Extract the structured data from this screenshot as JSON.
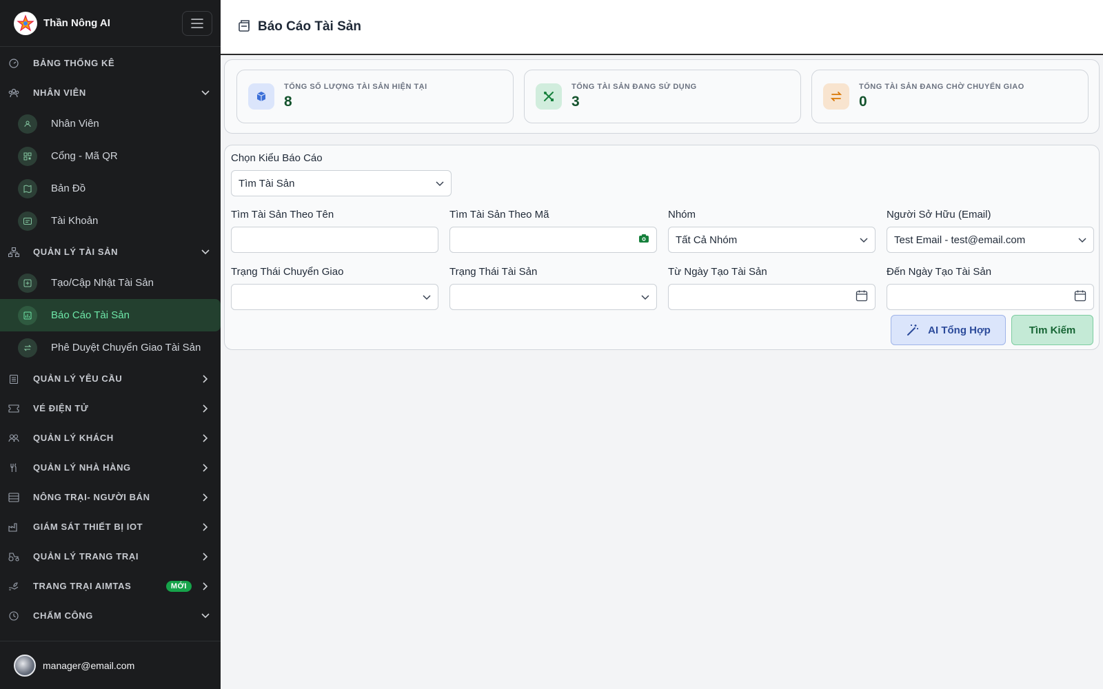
{
  "sidebar": {
    "brand": "Thần Nông AI",
    "sections": [
      {
        "label": "BẢNG THỐNG KÊ"
      },
      {
        "label": "NHÂN VIÊN",
        "items": [
          "Nhân Viên",
          "Cổng - Mã QR",
          "Bản Đồ",
          "Tài Khoản"
        ]
      },
      {
        "label": "QUẢN LÝ TÀI SẢN",
        "items": [
          "Tạo/Cập Nhật Tài Sản",
          "Báo Cáo Tài Sản",
          "Phê Duyệt Chuyển Giao Tài Sản"
        ]
      },
      {
        "label": "QUẢN LÝ YÊU CẦU"
      },
      {
        "label": "VÉ ĐIỆN TỬ"
      },
      {
        "label": "QUẢN LÝ KHÁCH"
      },
      {
        "label": "QUẢN LÝ NHÀ HÀNG"
      },
      {
        "label": "NÔNG TRẠI- NGƯỜI BÁN"
      },
      {
        "label": "GIÁM SÁT THIẾT BỊ IOT"
      },
      {
        "label": "QUẢN LÝ TRANG TRẠI"
      },
      {
        "label": "TRANG TRẠI AIMTAS",
        "badge": "MỚI"
      },
      {
        "label": "CHẤM CÔNG"
      }
    ],
    "user_email": "manager@email.com"
  },
  "header": {
    "title": "Báo Cáo Tài Sản"
  },
  "stats": [
    {
      "title": "TỔNG SỐ LƯỢNG TÀI SẢN HIỆN TẠI",
      "value": "8"
    },
    {
      "title": "TỔNG TÀI SẢN ĐANG SỬ DỤNG",
      "value": "3"
    },
    {
      "title": "TỔNG TÀI SẢN ĐANG CHỜ CHUYỂN GIAO",
      "value": "0"
    }
  ],
  "form": {
    "report_type_label": "Chọn Kiểu Báo Cáo",
    "report_type_value": "Tìm Tài Sản",
    "name_label": "Tìm Tài Sản Theo Tên",
    "code_label": "Tìm Tài Sản Theo Mã",
    "group_label": "Nhóm",
    "group_value": "Tất Cả Nhóm",
    "owner_label": "Người Sở Hữu (Email)",
    "owner_value": "Test Email - test@email.com",
    "transfer_status_label": "Trạng Thái Chuyển Giao",
    "asset_status_label": "Trạng Thái Tài Sản",
    "from_date_label": "Từ Ngày Tạo Tài Sản",
    "to_date_label": "Đến Ngày Tạo Tài Sản",
    "ai_button": "AI Tổng Hợp",
    "search_button": "Tìm Kiếm"
  }
}
